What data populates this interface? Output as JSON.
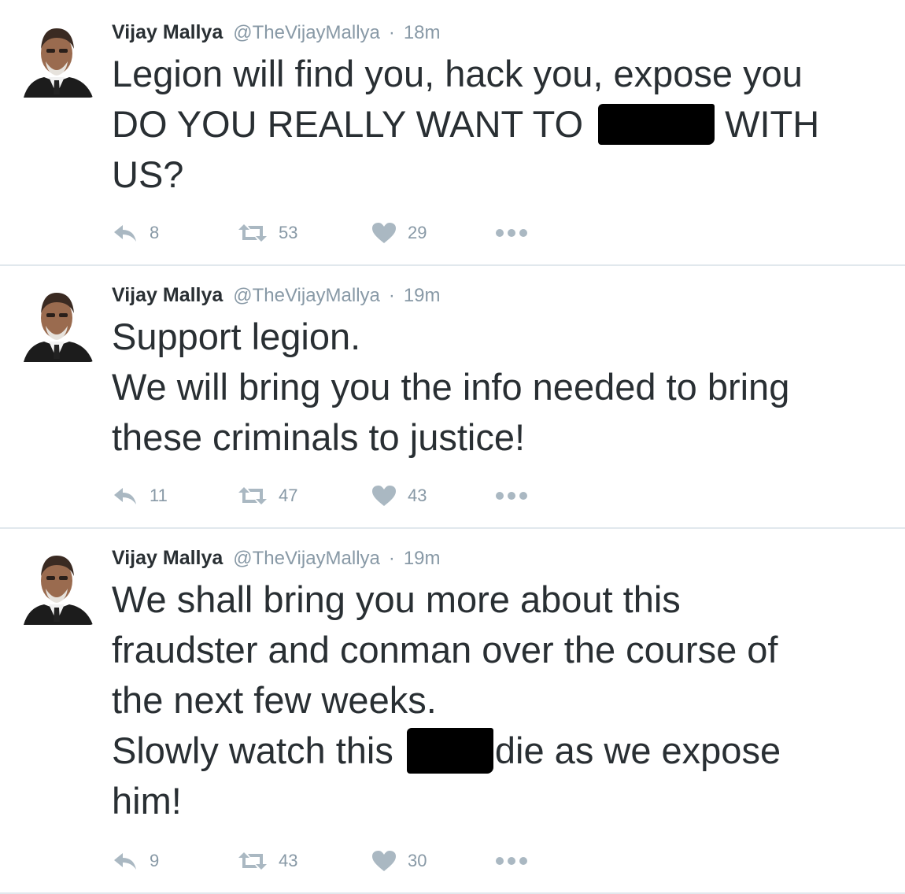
{
  "tweets": [
    {
      "name": "Vijay Mallya",
      "handle": "@TheVijayMallya",
      "separator": "·",
      "time": "18m",
      "lines": [
        [
          "Legion will find you, hack you, expose you"
        ],
        [
          "DO YOU REALLY WANT TO ",
          "[redacted]",
          " WITH"
        ],
        [
          "US?"
        ]
      ],
      "replies": "8",
      "retweets": "53",
      "likes": "29"
    },
    {
      "name": "Vijay Mallya",
      "handle": "@TheVijayMallya",
      "separator": "·",
      "time": "19m",
      "lines": [
        [
          "Support legion."
        ],
        [
          "We will bring you the info needed to bring"
        ],
        [
          "these criminals to justice!"
        ]
      ],
      "replies": "11",
      "retweets": "47",
      "likes": "43"
    },
    {
      "name": "Vijay Mallya",
      "handle": "@TheVijayMallya",
      "separator": "·",
      "time": "19m",
      "lines": [
        [
          "We shall bring you more about this"
        ],
        [
          "fraudster and conman over the course of"
        ],
        [
          "the next few weeks."
        ],
        [
          "Slowly watch this ",
          "[redacted]",
          "die as we expose"
        ],
        [
          "him!"
        ]
      ],
      "replies": "9",
      "retweets": "43",
      "likes": "30"
    }
  ],
  "icons": {
    "reply": "reply-icon",
    "retweet": "retweet-icon",
    "like": "heart-icon",
    "more": "more-options-icon"
  },
  "colors": {
    "text": "#292f33",
    "muted": "#8899a6",
    "divider": "#e1e8ed",
    "icon": "#aab8c2"
  }
}
